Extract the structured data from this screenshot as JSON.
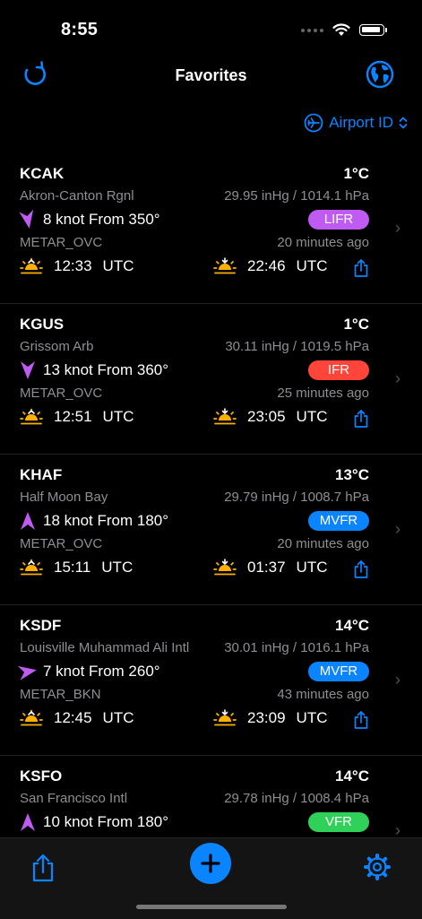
{
  "status": {
    "time": "8:55"
  },
  "nav": {
    "title": "Favorites"
  },
  "sort": {
    "label": "Airport ID"
  },
  "colors": {
    "accent": "#0a84ff",
    "LIFR": "#bf5af2",
    "IFR": "#ff453a",
    "MVFR": "#0a84ff",
    "VFR": "#30d158",
    "wind_arrow": "#bf5af2",
    "sun": "#ffb000"
  },
  "stations": [
    {
      "id": "KCAK",
      "temp": "1°C",
      "name": "Akron-Canton Rgnl",
      "pressure": "29.95 inHg / 1014.1 hPa",
      "wind": "8 knot From 350°",
      "wind_dir_deg": 350,
      "category": "LIFR",
      "type": "METAR_OVC",
      "age": "20 minutes ago",
      "sunrise": "12:33",
      "sunrise_tz": "UTC",
      "sunset": "22:46",
      "sunset_tz": "UTC"
    },
    {
      "id": "KGUS",
      "temp": "1°C",
      "name": "Grissom Arb",
      "pressure": "30.11 inHg / 1019.5 hPa",
      "wind": "13 knot From 360°",
      "wind_dir_deg": 360,
      "category": "IFR",
      "type": "METAR_OVC",
      "age": "25 minutes ago",
      "sunrise": "12:51",
      "sunrise_tz": "UTC",
      "sunset": "23:05",
      "sunset_tz": "UTC"
    },
    {
      "id": "KHAF",
      "temp": "13°C",
      "name": "Half Moon Bay",
      "pressure": "29.79 inHg / 1008.7 hPa",
      "wind": "18 knot From 180°",
      "wind_dir_deg": 180,
      "category": "MVFR",
      "type": "METAR_OVC",
      "age": "20 minutes ago",
      "sunrise": "15:11",
      "sunrise_tz": "UTC",
      "sunset": "01:37",
      "sunset_tz": "UTC"
    },
    {
      "id": "KSDF",
      "temp": "14°C",
      "name": "Louisville Muhammad Ali Intl",
      "pressure": "30.01 inHg / 1016.1 hPa",
      "wind": "7 knot From 260°",
      "wind_dir_deg": 260,
      "category": "MVFR",
      "type": "METAR_BKN",
      "age": "43 minutes ago",
      "sunrise": "12:45",
      "sunrise_tz": "UTC",
      "sunset": "23:09",
      "sunset_tz": "UTC"
    },
    {
      "id": "KSFO",
      "temp": "14°C",
      "name": "San Francisco Intl",
      "pressure": "29.78 inHg / 1008.4 hPa",
      "wind": "10 knot From 180°",
      "wind_dir_deg": 180,
      "category": "VFR"
    }
  ]
}
